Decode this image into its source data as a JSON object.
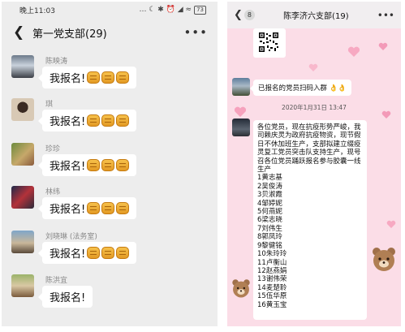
{
  "left": {
    "status": {
      "time": "晚上11:03",
      "icons": "… ☾ ✱ ⏰ ◢ ≈",
      "battery": "73"
    },
    "header": {
      "title": "第一党支部(29)",
      "back_icon": "chevron-left",
      "more_icon": "more-dots"
    },
    "messages": [
      {
        "sender": "陈映涛",
        "text": "我报名!",
        "fists": 3
      },
      {
        "sender": "琪",
        "text": "我报名!",
        "fists": 3
      },
      {
        "sender": "珍珍",
        "text": "我报名!",
        "fists": 3
      },
      {
        "sender": "林纬",
        "text": "我报名!",
        "fists": 3
      },
      {
        "sender": "刘晓琳 (法务室)",
        "text": "我报名!",
        "fists": 3
      },
      {
        "sender": "陈洪宜",
        "text": "我报名!",
        "fists": 0
      }
    ]
  },
  "right": {
    "header": {
      "badge": "8",
      "title": "陈李济六支部(19)",
      "back_icon": "chevron-left",
      "more_icon": "more-dots"
    },
    "qr_message": "qr-code",
    "notice": "已报名的党员扫码入群",
    "notice_emoji": "👌👌",
    "timestamp": "2020年1月31日 13:47",
    "long_message": "各位党员，现在抗疫形势严峻，我司赖庆灵为政府抗疫物资，现节假日不休加班生产，支部拟建立缀疫灵复工党员突击队支持生产，现号召各位党员踊跃报名参与胶囊一线生产",
    "names": [
      "1黄志基",
      "2吴俊涛",
      "3贝淑霞",
      "4邹婷妮",
      "5何燕妮",
      "6梁志晓",
      "7刘伟生",
      "8郭凤玲",
      "9黎健铭",
      "10朱玲玲",
      "11卢衡山",
      "12赵燕娟",
      "13谢伟荣",
      "14麦楚聆",
      "15伍华原",
      "16黄玉宝"
    ]
  },
  "colors": {
    "left_bg": "#ededed",
    "right_bg": "#fbdde7",
    "bubble": "#ffffff",
    "fist": "#f0b23a"
  }
}
